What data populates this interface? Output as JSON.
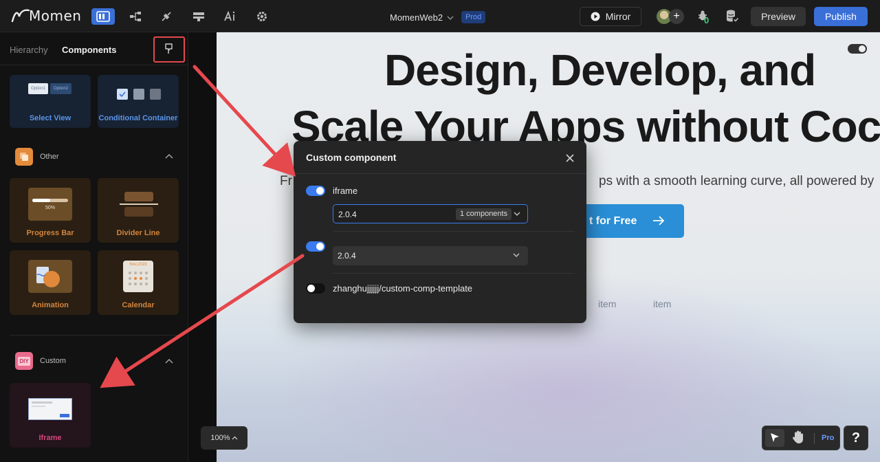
{
  "topbar": {
    "logo_text": "Momen",
    "project_name": "MomenWeb2",
    "env_badge": "Prod",
    "mirror_label": "Mirror",
    "notification_count": "0",
    "preview_label": "Preview",
    "publish_label": "Publish"
  },
  "sidebar": {
    "tabs": [
      {
        "label": "Hierarchy",
        "active": false
      },
      {
        "label": "Components",
        "active": true
      }
    ],
    "cards_top": [
      {
        "label": "Select View",
        "option1": "Option1",
        "option2": "Option2"
      },
      {
        "label": "Conditional Container"
      }
    ],
    "section_other": {
      "title": "Other",
      "items": [
        {
          "label": "Progress Bar",
          "value": "50%"
        },
        {
          "label": "Divider Line"
        },
        {
          "label": "Animation"
        },
        {
          "label": "Calendar",
          "month": "Nov,2023"
        }
      ]
    },
    "section_custom": {
      "title": "Custom",
      "icon_text": "DIY",
      "items": [
        {
          "label": "Iframe"
        }
      ]
    }
  },
  "canvas": {
    "headline_1": "Design, Develop, and",
    "headline_2": "Scale Your Apps without Coc",
    "subtitle_left": "Fr",
    "subtitle_right": "ps with a smooth learning curve, all powered by",
    "cta_label": "t for Free",
    "nav_items": [
      "item",
      "item"
    ],
    "zoom_label": "100%",
    "pro_label": "Pro",
    "help_label": "?"
  },
  "modal": {
    "title": "Custom component",
    "rows": [
      {
        "name": "iframe",
        "enabled": true,
        "version": "2.0.4",
        "components_badge": "1 components"
      },
      {
        "name": "",
        "enabled": true,
        "version": "2.0.4"
      },
      {
        "name": "zhanghujjjjjj/custom-comp-template",
        "enabled": false
      }
    ]
  },
  "colors": {
    "accent": "#3a6fd8",
    "annotation": "#e5484d"
  }
}
